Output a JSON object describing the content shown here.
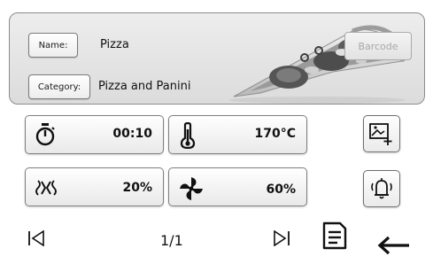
{
  "recipe": {
    "name_label": "Name:",
    "name_value": "Pizza",
    "category_label": "Category:",
    "category_value": "Pizza and Panini",
    "barcode_label": "Barcode"
  },
  "settings": {
    "time": "00:10",
    "temperature": "170°C",
    "humidity": "20%",
    "fan_speed": "60%"
  },
  "icons": {
    "time": "stopwatch-icon",
    "temperature": "thermometer-icon",
    "humidity": "humidity-icon",
    "fan": "fan-icon",
    "image": "add-image-icon",
    "alarm": "alarm-bell-icon",
    "first": "skip-first-icon",
    "last": "skip-last-icon",
    "save": "save-document-icon",
    "back": "back-arrow-icon"
  },
  "pagination": {
    "page": "1/1"
  }
}
